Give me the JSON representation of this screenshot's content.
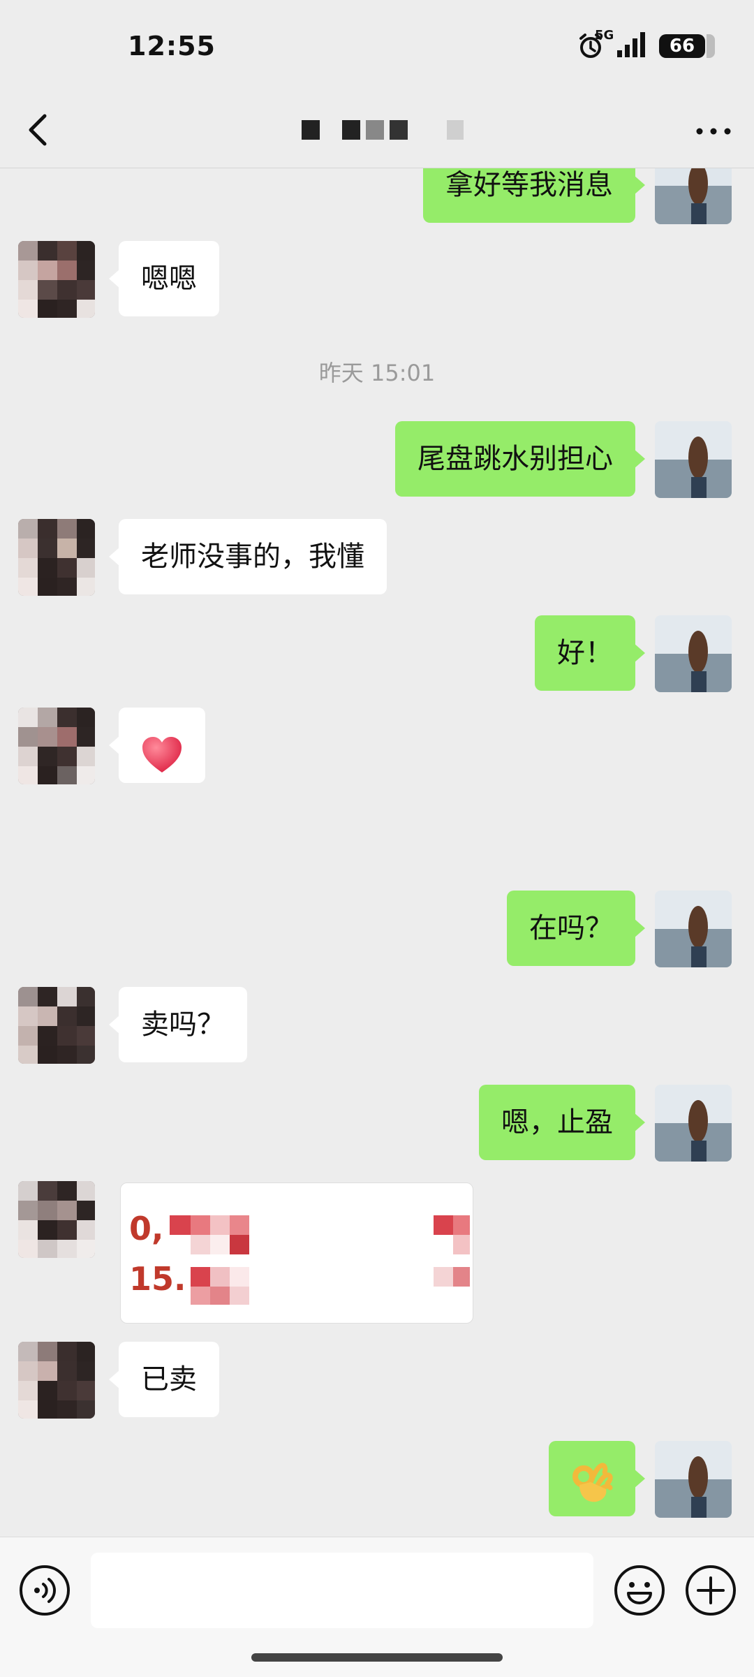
{
  "status_bar": {
    "time": "12:55",
    "network": "5G",
    "battery": "66"
  },
  "nav": {
    "back_icon": "chevron-left-icon",
    "more_icon": "more-dots-icon"
  },
  "messages": [
    {
      "side": "out",
      "text": "拿好等我消息"
    },
    {
      "side": "in",
      "text": "嗯嗯"
    },
    {
      "type": "timestamp",
      "text": "昨天 15:01"
    },
    {
      "side": "out",
      "text": "尾盘跳水别担心"
    },
    {
      "side": "in",
      "text": "老师没事的，我懂"
    },
    {
      "side": "out",
      "text": "好！"
    },
    {
      "side": "in",
      "type": "emoji",
      "text": "❤",
      "icon": "red-heart-icon"
    },
    {
      "side": "out",
      "text": "在吗？"
    },
    {
      "side": "in",
      "text": "卖吗？"
    },
    {
      "side": "out",
      "text": "嗯，止盈"
    },
    {
      "side": "in",
      "type": "image",
      "visible_text": [
        "0,",
        "15."
      ]
    },
    {
      "side": "in",
      "text": "已卖"
    },
    {
      "side": "out",
      "type": "emoji",
      "text": "👌",
      "icon": "ok-hand-icon"
    }
  ],
  "input_bar": {
    "voice_icon": "voice-icon",
    "emoji_icon": "smiley-icon",
    "plus_icon": "plus-circle-icon",
    "input_value": ""
  },
  "colors": {
    "background": "#ededed",
    "outgoing_bubble": "#95ec69",
    "incoming_bubble": "#ffffff",
    "timestamp": "#9a9a9a"
  }
}
